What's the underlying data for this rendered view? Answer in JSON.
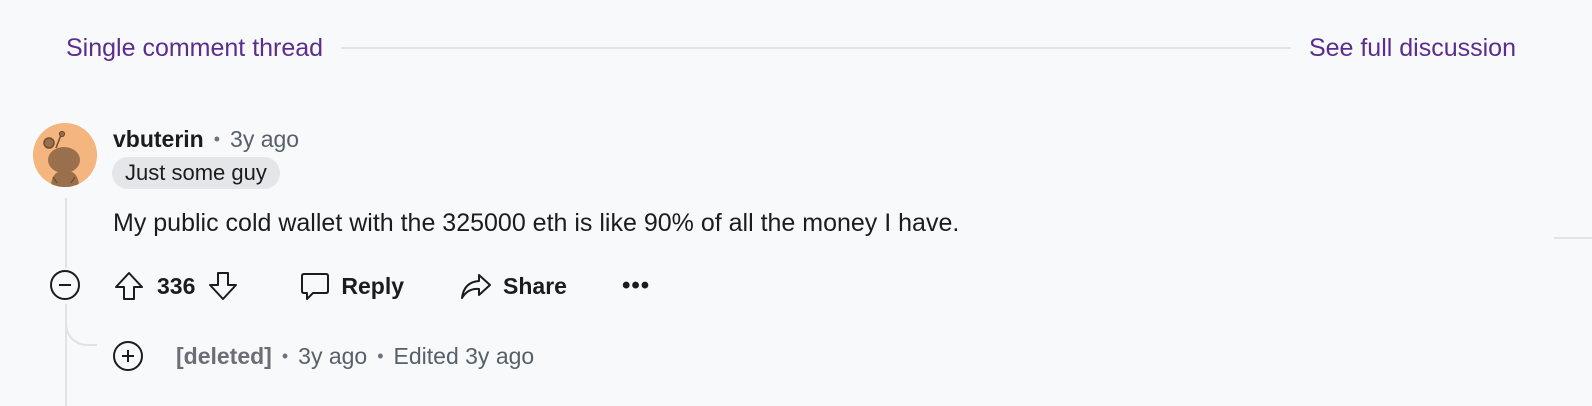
{
  "thread_header": {
    "single_thread_label": "Single comment thread",
    "full_discussion_label": "See full discussion",
    "link_color": "#5b2d8e"
  },
  "comment": {
    "author": "vbuterin",
    "time": "3y ago",
    "flair": "Just some guy",
    "body": "My public cold wallet with the 325000 eth is like 90% of all the money I have.",
    "score": "336",
    "avatar_color": "#f4b67e",
    "actions": {
      "reply_label": "Reply",
      "share_label": "Share",
      "more_label": "•••"
    }
  },
  "reply": {
    "author": "[deleted]",
    "time": "3y ago",
    "edited": "Edited 3y ago"
  },
  "icons": {
    "upvote": "arrow-up-outline-icon",
    "downvote": "arrow-down-outline-icon",
    "reply": "speech-bubble-icon",
    "share": "share-arrow-icon",
    "collapse": "circle-minus-icon",
    "expand": "circle-plus-icon"
  }
}
